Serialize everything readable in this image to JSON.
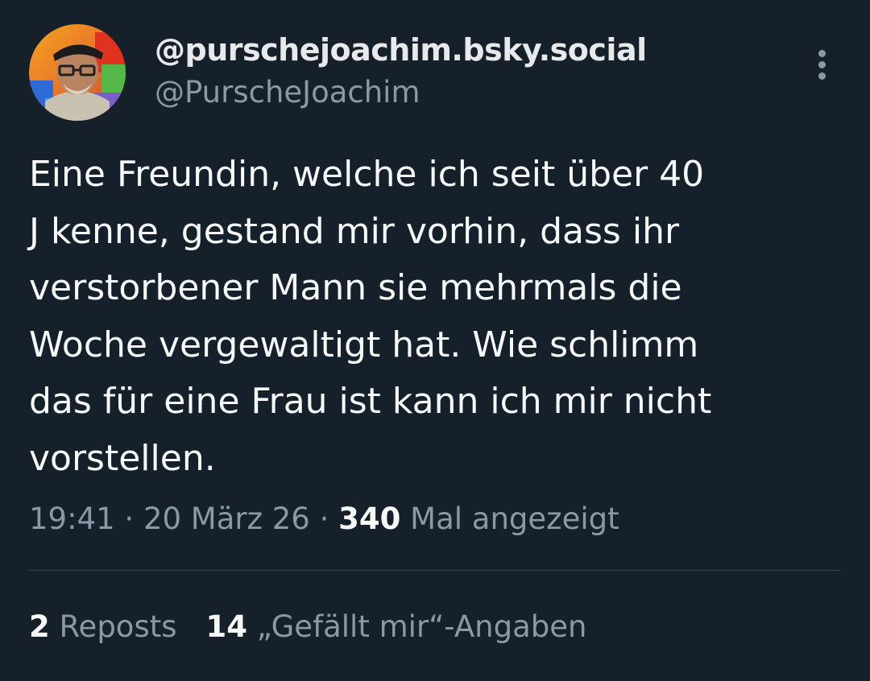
{
  "author": {
    "display_name": "@purschejoachim.bsky.social",
    "handle": "@PurscheJoachim"
  },
  "tweet": {
    "lines": [
      "Eine Freundin, welche ich seit über 40",
      "J kenne, gestand mir vorhin, dass ihr",
      "verstorbener Mann sie mehrmals die",
      "Woche vergewaltigt hat. Wie schlimm",
      "das für eine Frau ist kann ich mir nicht",
      "vorstellen."
    ],
    "time": "19:41",
    "separator": "·",
    "date": "20 März 26",
    "views_count": "340",
    "views_label": "Mal angezeigt"
  },
  "stats": {
    "reposts_count": "2",
    "reposts_label": "Reposts",
    "likes_count": "14",
    "likes_label": "„Gefällt mir“-Angaben"
  },
  "icons": {
    "more": "more-vertical-icon"
  },
  "colors": {
    "background": "#15202b",
    "text_primary": "#f7f9f9",
    "text_secondary": "#8b98a5",
    "divider": "#38444d"
  }
}
